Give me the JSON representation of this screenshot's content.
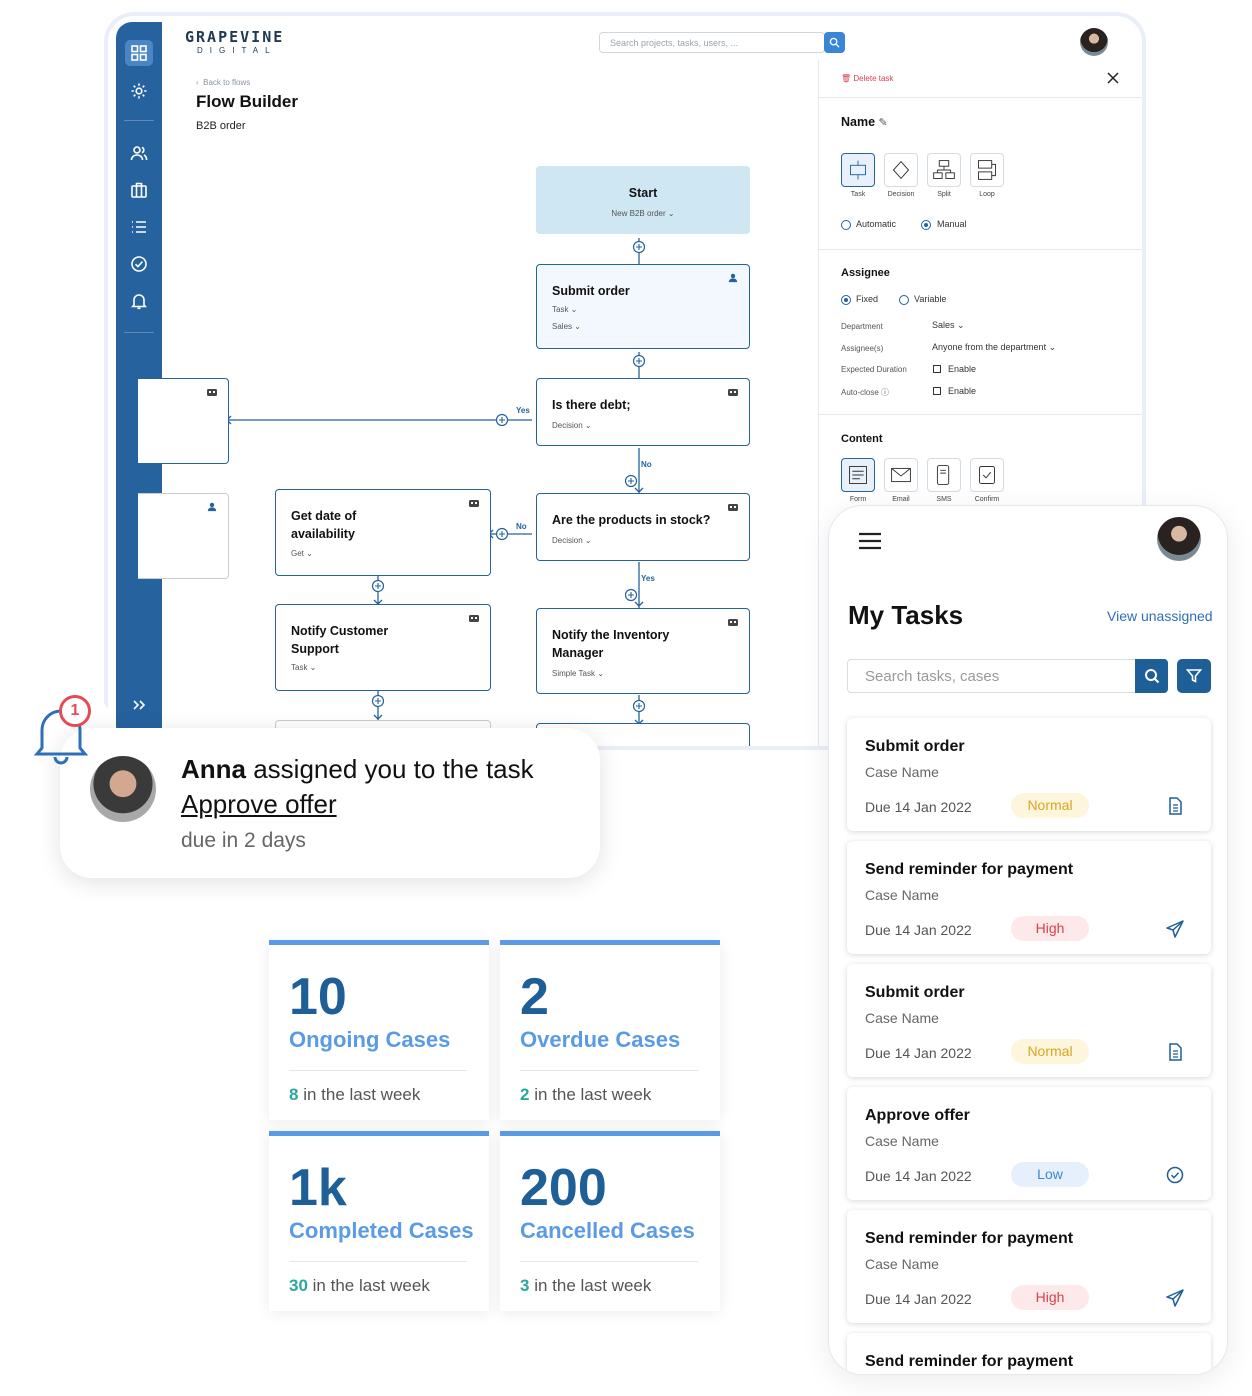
{
  "desktop": {
    "logo_main": "GRAPEVINE",
    "logo_sub": "DIGITAL",
    "search_placeholder": "Search projects, tasks, users, ...",
    "back_link": "Back to flows",
    "page_title": "Flow Builder",
    "page_subtitle": "B2B order",
    "flow": {
      "start": {
        "title": "Start",
        "sub": "New B2B order"
      },
      "submit": {
        "title": "Submit order",
        "sub1": "Task",
        "sub2": "Sales"
      },
      "debt": {
        "title": "Is there debt;",
        "sub": "Decision"
      },
      "stock": {
        "title": "Are the products in stock?",
        "sub": "Decision"
      },
      "avail": {
        "title": "Get date of availability",
        "sub": "Get"
      },
      "support": {
        "title": "Notify Customer Support",
        "sub": "Task"
      },
      "inventory": {
        "title": "Notify the Inventory Manager",
        "sub": "Simple Task"
      },
      "labels": {
        "yes": "Yes",
        "no": "No"
      }
    },
    "panel": {
      "delete": "Delete task",
      "name_label": "Name",
      "types": [
        "Task",
        "Decision",
        "Split",
        "Loop"
      ],
      "mode_auto": "Automatic",
      "mode_manual": "Manual",
      "assignee_label": "Assignee",
      "fixed": "Fixed",
      "variable": "Variable",
      "department_label": "Department",
      "department_value": "Sales",
      "assignees_label": "Assignee(s)",
      "assignees_value": "Anyone from the department",
      "duration_label": "Expected Duration",
      "autoclose_label": "Auto-close",
      "enable": "Enable",
      "content_label": "Content",
      "contents": [
        "Form",
        "Email",
        "SMS",
        "Confirm"
      ]
    }
  },
  "notification": {
    "badge": "1",
    "actor": "Anna",
    "message": " assigned you to the task",
    "task": "Approve offer",
    "due": "due in 2 days"
  },
  "stats": [
    {
      "value": "10",
      "label": "Ongoing Cases",
      "week_num": "8",
      "week_text": " in the last week"
    },
    {
      "value": "2",
      "label": "Overdue Cases",
      "week_num": "2",
      "week_text": " in the last week"
    },
    {
      "value": "1k",
      "label": "Completed Cases",
      "week_num": "30",
      "week_text": " in the last week"
    },
    {
      "value": "200",
      "label": "Cancelled Cases",
      "week_num": "3",
      "week_text": " in the last week"
    }
  ],
  "mobile": {
    "title": "My Tasks",
    "view_unassigned": "View unassigned",
    "search_placeholder": "Search tasks, cases",
    "tasks": [
      {
        "title": "Submit order",
        "case": "Case Name",
        "due": "Due 14 Jan 2022",
        "priority": "Normal",
        "icon": "document-icon"
      },
      {
        "title": "Send reminder for payment",
        "case": "Case Name",
        "due": "Due 14 Jan 2022",
        "priority": "High",
        "icon": "send-icon"
      },
      {
        "title": "Submit order",
        "case": "Case Name",
        "due": "Due 14 Jan 2022",
        "priority": "Normal",
        "icon": "document-icon"
      },
      {
        "title": "Approve offer",
        "case": "Case Name",
        "due": "Due 14 Jan 2022",
        "priority": "Low",
        "icon": "check-circle-icon"
      },
      {
        "title": "Send reminder for payment",
        "case": "Case Name",
        "due": "Due 14 Jan 2022",
        "priority": "High",
        "icon": "send-icon"
      },
      {
        "title": "Send reminder for payment"
      }
    ]
  },
  "colors": {
    "primary": "#25629e",
    "accent": "#5b9be6",
    "normal_bg": "#fdf6dc",
    "normal_fg": "#d9a520",
    "high_bg": "#fde8ea",
    "high_fg": "#d9414e",
    "low_bg": "#e6f0fc",
    "low_fg": "#3a86d6"
  }
}
